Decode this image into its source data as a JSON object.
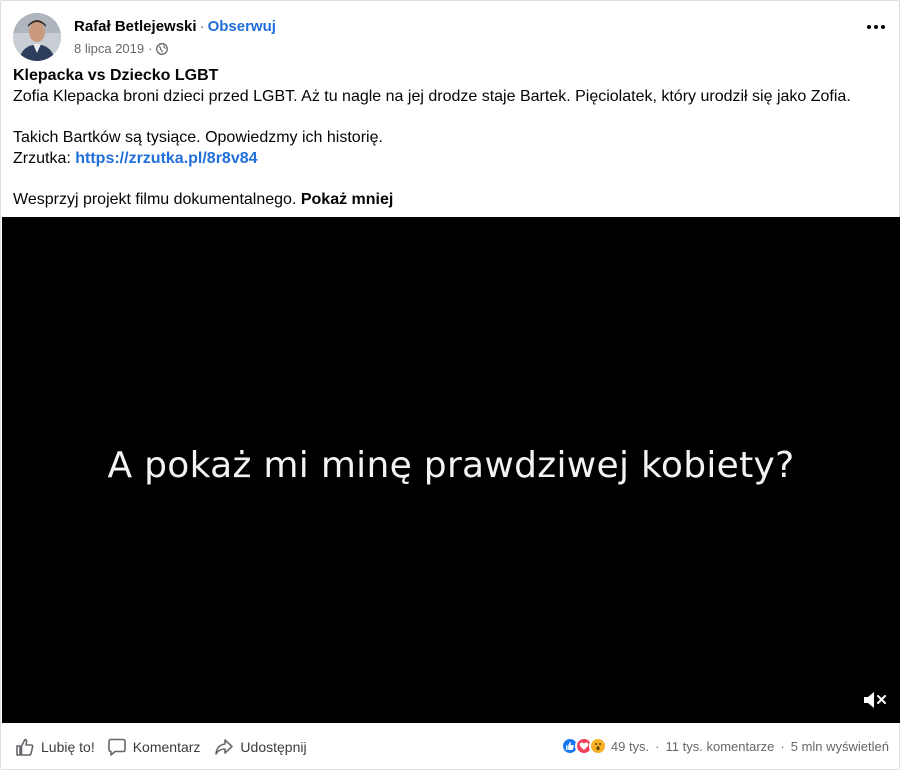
{
  "post": {
    "author": "Rafał Betlejewski",
    "follow_separator": "·",
    "follow_label": "Obserwuj",
    "date": "8 lipca 2019",
    "date_separator": "·",
    "privacy_icon": "globe-icon",
    "more_icon": "more-horizontal-icon",
    "title": "Klepacka vs Dziecko LGBT",
    "line1": "Zofia Klepacka broni dzieci przed LGBT. Aż tu nagle na jej drodze staje Bartek. Pięciolatek, który urodził się jako Zofia.",
    "line2": "Takich Bartków są tysiące. Opowiedzmy ich historię.",
    "link_prefix": "Zrzutka:",
    "link_text": "https://zrzutka.pl/8r8v84",
    "line4": "Wesprzyj projekt filmu dokumentalnego.",
    "show_less": "Pokaż mniej"
  },
  "video": {
    "subtitle": "A pokaż mi minę prawdziwej kobiety?",
    "mute_icon": "volume-muted-icon"
  },
  "actions": {
    "like_label": "Lubię to!",
    "comment_label": "Komentarz",
    "share_label": "Udostępnij"
  },
  "stats": {
    "reactions_count": "49 tys.",
    "comments": "11 tys. komentarze",
    "views": "5 mln wyświetleń",
    "separator": "·",
    "reaction_icons": [
      "like-reaction-icon",
      "love-reaction-icon",
      "wow-reaction-icon"
    ]
  },
  "colors": {
    "link": "#216fdb",
    "secondary_text": "#65676b",
    "like_blue": "#1877f2",
    "love_red": "#f33e58",
    "wow_yellow": "#f7b125"
  }
}
